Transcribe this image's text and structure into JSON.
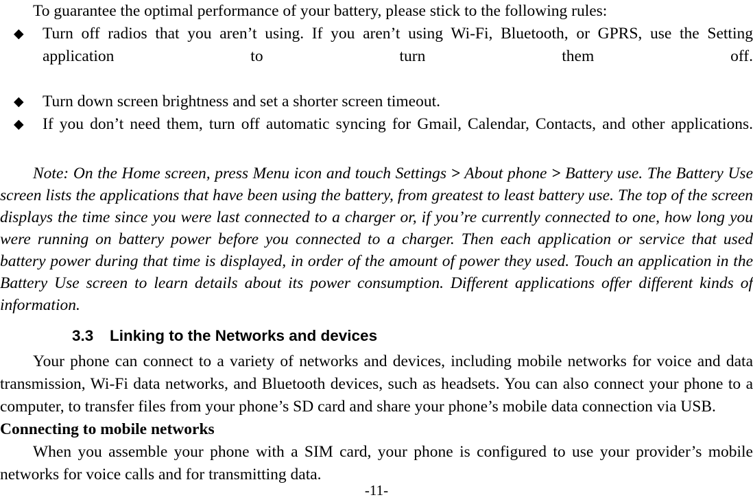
{
  "document": {
    "intro_paragraph": "To guarantee the optimal performance of your battery, please stick to the following rules:",
    "bullet_marker": "◆",
    "bullets": [
      "Turn off radios that you aren’t using. If you aren’t using Wi-Fi, Bluetooth, or GPRS, use the Setting application to turn them off.",
      "Turn down screen brightness and set a shorter screen timeout.",
      "If you don’t need them, turn off automatic syncing for Gmail, Calendar, Contacts, and other applications."
    ],
    "note": {
      "segment_1": "Note: On the Home screen, press Menu icon and touch Settings ",
      "chevron_1": ">",
      "segment_2": " About phone ",
      "chevron_2": ">",
      "segment_3": " Battery use. The Battery Use screen lists the applications that have been using the battery, from greatest to least battery use. The top of the screen displays the time since you were last connected to a charger or, if you’re currently connected to one, how long you were running on battery power before you connected to a charger. Then each application or service that used battery power during that time is displayed, in order of the amount of power they used. Touch an application in the Battery Use screen to learn details about its power consumption. Different applications offer different kinds of information."
    },
    "section": {
      "number": "3.3",
      "title": "Linking to the Networks and devices",
      "body": "Your phone can connect to a variety of networks and devices, including mobile networks for voice and data transmission, Wi-Fi data networks, and Bluetooth devices, such as headsets. You can also connect your phone to a computer, to transfer files from your phone’s SD card and share your phone’s mobile data connection via USB."
    },
    "subsection": {
      "title": "Connecting to mobile networks",
      "body": "When you assemble your phone with a SIM card, your phone is configured to use your provider’s mobile networks for voice calls and for transmitting data."
    },
    "footer": {
      "page_number": "-11-"
    }
  }
}
